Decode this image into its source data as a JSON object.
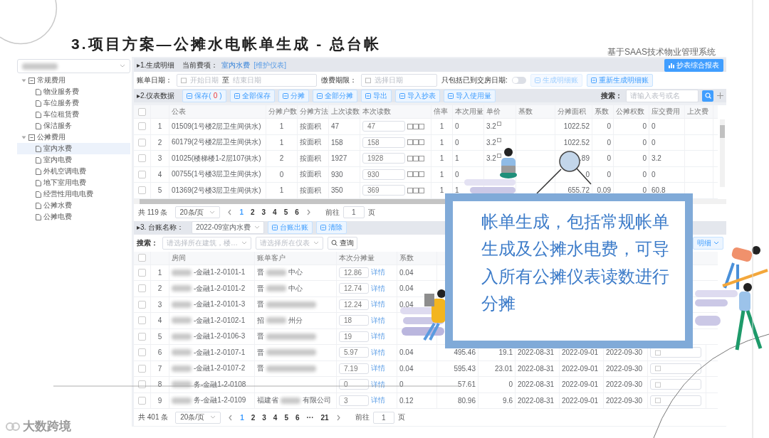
{
  "slide": {
    "title": "3.项目方案—公摊水电帐单生成 - 总台帐",
    "subtitle": "基于SAAS技术物业管理系统",
    "logo": "大数跨境"
  },
  "callout": {
    "text": "帐单生成，包括常规帐单生成及公摊水电费，可导入所有公摊仪表读数进行分摊"
  },
  "sidebar": {
    "select_blurred": true,
    "groups": [
      {
        "label": "常规费用",
        "expanded": true,
        "children": [
          {
            "label": "物业服务费",
            "selected": false
          },
          {
            "label": "车位服务费",
            "selected": false
          },
          {
            "label": "车位租赁费",
            "selected": false
          },
          {
            "label": "保洁服务",
            "selected": false
          }
        ]
      },
      {
        "label": "公摊费用",
        "expanded": true,
        "children": [
          {
            "label": "室内水费",
            "selected": true
          },
          {
            "label": "室内电费",
            "selected": false
          },
          {
            "label": "外机空调电费",
            "selected": false
          },
          {
            "label": "地下室用电费",
            "selected": false
          },
          {
            "label": "经营性用电电费",
            "selected": false
          },
          {
            "label": "公摊水费",
            "selected": false
          },
          {
            "label": "公摊电费",
            "selected": false
          }
        ]
      }
    ]
  },
  "section1": {
    "title": "▸1.生成明细",
    "fee_label": "当前费项：",
    "fee": "室内水费",
    "maintain_link": "[维护仪表]",
    "report_button": "抄表综合报表"
  },
  "filters": {
    "bill_date_label": "账单日期：",
    "start_placeholder": "开始日期",
    "range_sep": "至",
    "end_placeholder": "结束日期",
    "due_label": "缴费期限：",
    "due_placeholder": "选择日期",
    "toggle_label": "只包括已到交房日期:",
    "toggle_on": false,
    "buttons": [
      {
        "label": "生成明细账",
        "disabled": true
      },
      {
        "label": "重新生成明细账",
        "disabled": false
      }
    ]
  },
  "section2": {
    "title": "▸2.仪表数据",
    "buttons": [
      {
        "label": "保存(",
        "count": "0",
        "suffix": ")"
      },
      {
        "label": "全部保存"
      },
      {
        "label": "分摊"
      },
      {
        "label": "全部分摊"
      },
      {
        "label": "导出"
      },
      {
        "label": "导入抄表"
      },
      {
        "label": "导入使用量"
      }
    ],
    "search_label": "搜索：",
    "search_placeholder": "请输入表号或名"
  },
  "meter_table": {
    "select_all_checked": false,
    "columns": [
      {
        "kind": "index"
      },
      {
        "label": "公表",
        "kind": "text"
      },
      {
        "label": "分摊户数",
        "kind": "center"
      },
      {
        "label": "分摊方法",
        "kind": "text"
      },
      {
        "label": "上次读数",
        "kind": "text"
      },
      {
        "label": "本次读数",
        "kind": "input"
      },
      {
        "label": "倍率",
        "kind": "center"
      },
      {
        "label": "本次用量",
        "kind": "text"
      },
      {
        "label": "单价",
        "kind": "price"
      },
      {
        "label": "基数",
        "kind": "num"
      },
      {
        "label": "分摊面积",
        "kind": "num"
      },
      {
        "label": "系数",
        "kind": "num"
      },
      {
        "label": "公摊权数",
        "kind": "num"
      },
      {
        "label": "应交费用",
        "kind": "text"
      },
      {
        "label": "上次费",
        "kind": "text"
      }
    ],
    "rows": [
      {
        "checked": false,
        "cells": [
          "1",
          "01509(1号楼2层卫生间供水)",
          "1",
          "按面积",
          "47",
          "47",
          "1",
          "0",
          "3.2",
          null,
          "1022.52",
          "0",
          "0",
          "0",
          null
        ]
      },
      {
        "checked": false,
        "cells": [
          "2",
          "60179(2号楼2层卫生间供水)",
          "1",
          "按面积",
          "158",
          "158",
          "1",
          "0",
          "3.2",
          null,
          "1022.52",
          "0",
          "0",
          "0",
          null
        ]
      },
      {
        "checked": false,
        "cells": [
          "3",
          "01025(楼梯楼1-2层107供水)",
          "2",
          "按面积",
          "1927",
          "1928",
          "1",
          "1",
          "3.2",
          null,
          ".89",
          "0",
          "0",
          "3.2",
          null
        ]
      },
      {
        "checked": false,
        "cells": [
          "4",
          "00755(1号楼3层卫生间供水)",
          "0",
          "按面积",
          "930",
          "930",
          "1",
          "0",
          null,
          null,
          "0",
          "0",
          "0",
          "0",
          null
        ]
      },
      {
        "checked": false,
        "cells": [
          "5",
          "01369(2号楼3层卫生间供水)",
          "1",
          "按面积",
          "350",
          "369",
          "1",
          "1",
          null,
          null,
          "655.72",
          "0.09",
          "0",
          "60.8",
          null
        ]
      }
    ]
  },
  "pagination_1": {
    "total": "共 119 条",
    "page_size": "20条/页",
    "pages": [
      {
        "label": "1",
        "selected": true
      },
      {
        "label": "2",
        "selected": false
      },
      {
        "label": "3",
        "selected": false
      },
      {
        "label": "4",
        "selected": false
      },
      {
        "label": "5",
        "selected": false
      },
      {
        "label": "6",
        "selected": false
      }
    ],
    "goto_label": "前往",
    "goto_value": "1",
    "page_unit": "页"
  },
  "section3": {
    "title": "▸3. 台账名称：",
    "ledger": "2022-09室内水费",
    "buttons": [
      "台账出账",
      "清除"
    ],
    "search_label": "搜索：",
    "building_placeholder": "请选择所在建筑，楼…",
    "meter_placeholder": "请选择所在仪表",
    "query_button": "查询",
    "detail_button": "明细"
  },
  "ledger_table": {
    "select_all_checked": false,
    "columns": [
      {
        "label": "房间"
      },
      {
        "label": "账单客户"
      },
      {
        "label": "本次分摊量"
      },
      {
        "label": "系数"
      }
    ],
    "rows": [
      {
        "checked": false,
        "index": "1",
        "room": "-金融1-2-0101-1",
        "room_blurred": true,
        "customer_pre": "晋",
        "customer_post": "中心",
        "customer_blurred": true,
        "share": "12.86",
        "link": "详情",
        "coef": "0.04"
      },
      {
        "checked": false,
        "index": "2",
        "room": "-金融1-2-0101-2",
        "room_blurred": true,
        "customer_pre": "晋",
        "customer_post": "中心",
        "customer_blurred": true,
        "share": "12.74",
        "link": "详情",
        "coef": "0.04"
      },
      {
        "checked": false,
        "index": "3",
        "room": "-金融1-2-0101-3",
        "room_blurred": true,
        "customer_pre": "晋",
        "customer_blurred": true,
        "share": "12.24",
        "link": "详情",
        "coef": "0.04"
      },
      {
        "checked": false,
        "index": "4",
        "room": "-金融1-2-0102-1",
        "room_blurred": true,
        "customer_pre": "招",
        "customer_post": "州分",
        "customer_blurred": true,
        "share": "18",
        "link": "详情"
      },
      {
        "checked": false,
        "index": "5",
        "room": "-金融1-2-0106-3",
        "room_blurred": true,
        "customer_pre": "晋",
        "customer_blurred": true,
        "share": "19",
        "link": "详情"
      },
      {
        "checked": false,
        "index": "6",
        "room": "-金融1-2-0107-1",
        "room_blurred": true,
        "customer_pre": "晋",
        "customer_blurred": true,
        "share": "5.97",
        "link": "详情",
        "coef": "0.04",
        "extra": [
          "495.46",
          "19.1",
          "2022-08-31",
          "2022-09-01",
          "2022-09-30"
        ]
      },
      {
        "checked": false,
        "index": "7",
        "room": "-金融1-2-0107-2",
        "room_blurred": true,
        "customer_pre": "晋",
        "customer_blurred": true,
        "share": "7.19",
        "link": "详情",
        "coef": "0.04",
        "extra": [
          "595.43",
          "23.01",
          "2022-08-31",
          "2022-09-01",
          "2022-09-30"
        ]
      },
      {
        "checked": false,
        "index": "8",
        "room": "务-金融1-2-0108",
        "room_blurred": true,
        "share": "0",
        "link": "详情",
        "coef": "0",
        "extra": [
          "57.61",
          "0",
          "2022-08-31",
          "2022-09-01",
          "2022-09-30"
        ]
      },
      {
        "checked": false,
        "index": "9",
        "room": "务-金融1-2-0109",
        "room_blurred": true,
        "customer_pre": "福建省",
        "customer_post": "有限公司",
        "customer_blurred": true,
        "share": "3",
        "link": "详情",
        "coef": "0.12",
        "extra": [
          "80.96",
          "9.6",
          "2022-08-31",
          "2022-09-01",
          "2022-09-30"
        ]
      }
    ]
  },
  "pagination_2": {
    "total": "共 401 条",
    "page_size": "20条/页",
    "pages": [
      {
        "label": "1",
        "selected": true
      },
      {
        "label": "2",
        "selected": false
      },
      {
        "label": "3",
        "selected": false
      },
      {
        "label": "4",
        "selected": false
      },
      {
        "label": "5",
        "selected": false
      },
      {
        "label": "6",
        "selected": false
      },
      {
        "label": "···",
        "selected": false
      },
      {
        "label": "21",
        "selected": false
      }
    ],
    "goto_label": "前往",
    "goto_value": "1",
    "page_unit": "页"
  }
}
